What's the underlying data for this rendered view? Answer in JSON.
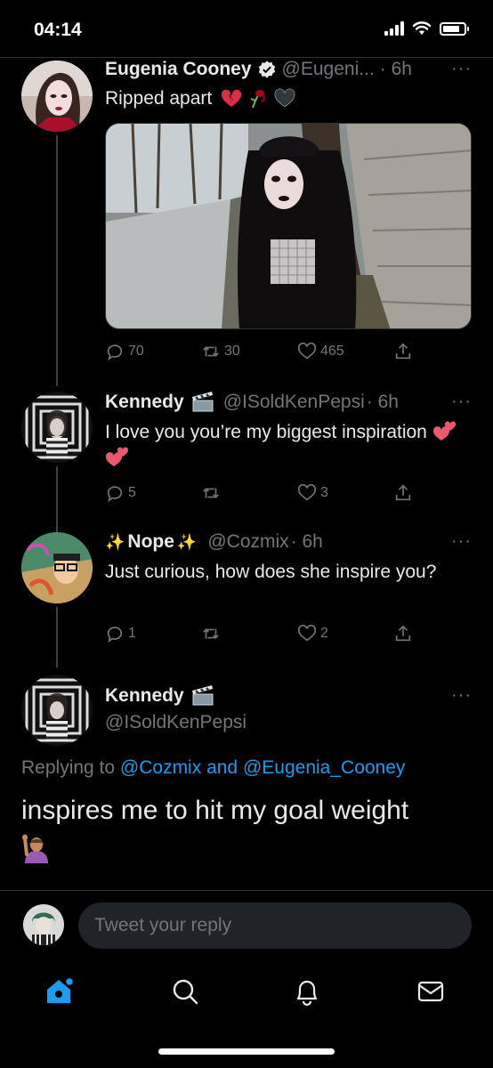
{
  "status_bar": {
    "time": "04:14"
  },
  "tweets": [
    {
      "name": "Eugenia Cooney",
      "handle": "@Eugeni...",
      "time": "· 6h",
      "text": "Ripped apart",
      "emojis": [
        "broken-heart",
        "wilted-rose",
        "black-heart"
      ],
      "verified": true,
      "counts": {
        "replies": "70",
        "retweets": "30",
        "likes": "465"
      }
    },
    {
      "name": "Kennedy",
      "handle": "@ISoldKenPepsi",
      "time": "· 6h",
      "text": "I love you you’re my biggest inspiration",
      "counts": {
        "replies": "5",
        "retweets": "",
        "likes": "3"
      }
    },
    {
      "name": "Nope",
      "handle": "@Cozmix",
      "time": "· 6h",
      "text": "Just curious, how does she inspire you?",
      "counts": {
        "replies": "1",
        "retweets": "",
        "likes": "2"
      }
    }
  ],
  "focused_tweet": {
    "name": "Kennedy",
    "handle": "@ISoldKenPepsi",
    "replying_prefix": "Replying to",
    "replying_user1": "@Cozmix",
    "replying_and": "and",
    "replying_user2": "@Eugenia_Cooney",
    "text": "inspires me to hit my goal weight"
  },
  "composer": {
    "placeholder": "Tweet your reply"
  },
  "more_label": "···",
  "colors": {
    "accent": "#1d9bf0",
    "muted": "#71767b",
    "background": "#000000",
    "heart": "#e0245e"
  }
}
